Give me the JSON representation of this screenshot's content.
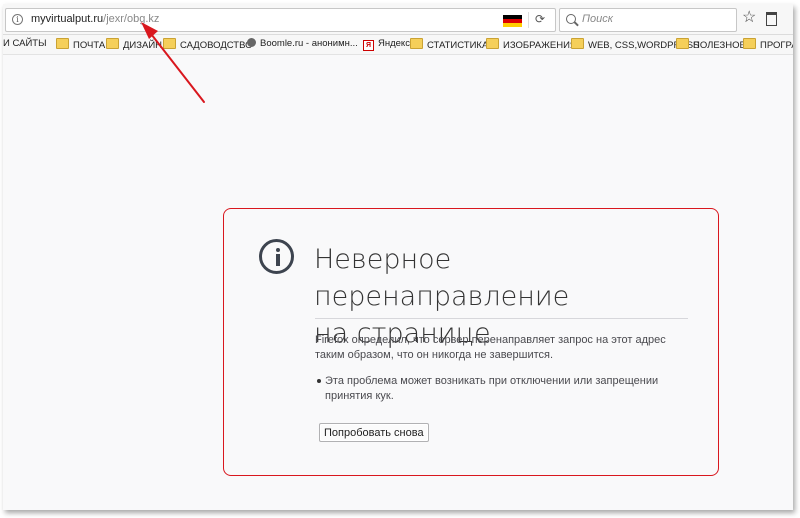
{
  "toolbar": {
    "url_domain": "myvirtualput.ru",
    "url_path": "/jexr/obg.kz",
    "search_placeholder": "Поиск"
  },
  "bookmarks": [
    {
      "label": "И САЙТЫ",
      "icon": "none"
    },
    {
      "label": "ПОЧТА",
      "icon": "folder-icon"
    },
    {
      "label": "ДИЗАЙН",
      "icon": "folder-icon"
    },
    {
      "label": "САДОВОДСТВО",
      "icon": "folder-icon"
    },
    {
      "label": "Boomle.ru - анонимн...",
      "icon": "globe-icon"
    },
    {
      "label": "Яндекс",
      "icon": "yandex-icon"
    },
    {
      "label": "СТАТИСТИКА",
      "icon": "folder-icon"
    },
    {
      "label": "ИЗОБРАЖЕНИЯ",
      "icon": "folder-icon"
    },
    {
      "label": "WEB, CSS,WORDPRESS",
      "icon": "folder-icon"
    },
    {
      "label": "ПОЛЕЗНОЕ",
      "icon": "folder-icon"
    },
    {
      "label": "ПРОГРА",
      "icon": "folder-icon"
    }
  ],
  "error": {
    "title_line1": "Неверное перенаправление",
    "title_line2": "на странице",
    "description_line1": "Firefox определил, что сервер перенаправляет запрос на этот адрес",
    "description_line2": "таким образом, что он никогда не завершится.",
    "bullet_line1": "Эта проблема может возникать при отключении или запрещении",
    "bullet_line2": "принятия кук.",
    "retry_button": "Попробовать снова"
  },
  "colors": {
    "highlight_border": "#d9171e",
    "arrow": "#d9171e",
    "page_background": "#f9f9fa"
  }
}
